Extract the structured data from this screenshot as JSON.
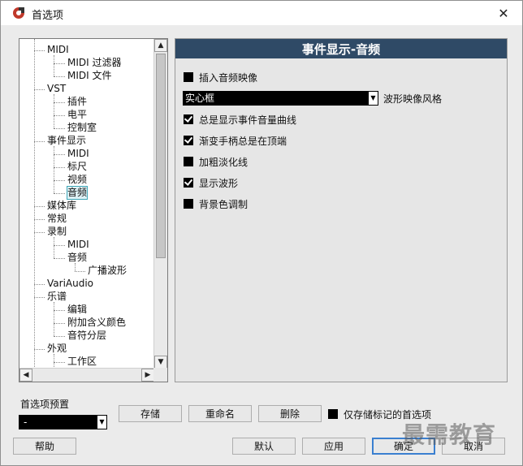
{
  "window": {
    "title": "首选项",
    "close_glyph": "✕"
  },
  "tree": {
    "items": [
      {
        "label": "MIDI",
        "level": 1,
        "connector": "mid"
      },
      {
        "label": "MIDI 过滤器",
        "level": 2,
        "connector": "mid"
      },
      {
        "label": "MIDI 文件",
        "level": 2,
        "connector": "end"
      },
      {
        "label": "VST",
        "level": 1,
        "connector": "mid"
      },
      {
        "label": "插件",
        "level": 2,
        "connector": "mid"
      },
      {
        "label": "电平",
        "level": 2,
        "connector": "mid"
      },
      {
        "label": "控制室",
        "level": 2,
        "connector": "end"
      },
      {
        "label": "事件显示",
        "level": 1,
        "connector": "mid"
      },
      {
        "label": "MIDI",
        "level": 2,
        "connector": "mid"
      },
      {
        "label": "标尺",
        "level": 2,
        "connector": "mid"
      },
      {
        "label": "视频",
        "level": 2,
        "connector": "mid"
      },
      {
        "label": "音频",
        "level": 2,
        "connector": "end",
        "selected": true
      },
      {
        "label": "媒体库",
        "level": 1,
        "connector": "mid"
      },
      {
        "label": "常规",
        "level": 1,
        "connector": "mid"
      },
      {
        "label": "录制",
        "level": 1,
        "connector": "mid"
      },
      {
        "label": "MIDI",
        "level": 2,
        "connector": "mid"
      },
      {
        "label": "音频",
        "level": 2,
        "connector": "end"
      },
      {
        "label": "广播波形",
        "level": 3,
        "connector": "end"
      },
      {
        "label": "VariAudio",
        "level": 1,
        "connector": "mid"
      },
      {
        "label": "乐谱",
        "level": 1,
        "connector": "mid"
      },
      {
        "label": "编辑",
        "level": 2,
        "connector": "mid"
      },
      {
        "label": "附加含义颜色",
        "level": 2,
        "connector": "mid"
      },
      {
        "label": "音符分层",
        "level": 2,
        "connector": "end"
      },
      {
        "label": "外观",
        "level": 1,
        "connector": "mid"
      },
      {
        "label": "工作区",
        "level": 2,
        "connector": "mid"
      }
    ],
    "scroll_up_glyph": "▲",
    "scroll_down_glyph": "▼",
    "scroll_left_glyph": "◀",
    "scroll_right_glyph": "▶"
  },
  "panel": {
    "header": "事件显示-音频",
    "options": [
      {
        "label": "插入音频映像",
        "checked": false
      },
      {
        "label": "总是显示事件音量曲线",
        "checked": true
      },
      {
        "label": "渐变手柄总是在顶端",
        "checked": true
      },
      {
        "label": "加粗淡化线",
        "checked": false
      },
      {
        "label": "显示波形",
        "checked": true
      },
      {
        "label": "背景色调制",
        "checked": false
      }
    ],
    "waveform_style": {
      "value": "实心框",
      "label": "波形映像风格",
      "arrow": "▼"
    }
  },
  "bottom": {
    "preset_label": "首选项预置",
    "preset_value": "-",
    "save_label": "存储",
    "rename_label": "重命名",
    "delete_label": "删除",
    "only_marked_label": "仅存储标记的首选项",
    "help_label": "帮助",
    "default_label": "默认",
    "apply_label": "应用",
    "ok_label": "确定",
    "cancel_label": "取消",
    "watermark": "最需教育"
  },
  "colors": {
    "header_bg": "#2f4a66",
    "selected_outline": "#3fa6b7",
    "app_icon": "#c0392b"
  }
}
